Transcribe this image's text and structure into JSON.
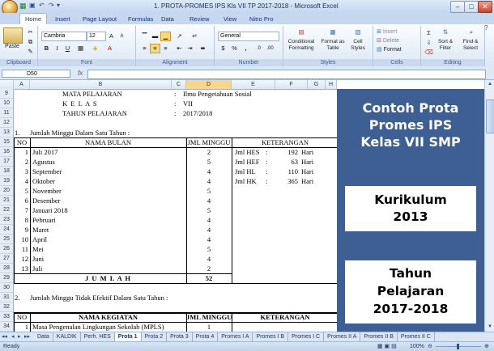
{
  "window": {
    "title": "1. PROTA-PROMES IPS Kls VII TP 2017-2018 - Microsoft Excel"
  },
  "ribbon": {
    "tabs": [
      "Home",
      "Insert",
      "Page Layout",
      "Formulas",
      "Data",
      "Review",
      "View",
      "Nitro Pro"
    ],
    "active_tab": "Home",
    "groups": {
      "clipboard": "Clipboard",
      "font": "Font",
      "alignment": "Alignment",
      "number": "Number",
      "styles": "Styles",
      "cells": "Cells",
      "editing": "Editing"
    },
    "paste_label": "Paste",
    "font_name": "Cambria",
    "font_size": "12",
    "number_format": "General",
    "conditional_formatting": "Conditional Formatting",
    "format_as_table": "Format as Table",
    "cell_styles": "Cell Styles",
    "insert": "Insert",
    "delete": "Delete",
    "format": "Format",
    "sort_filter": "Sort & Filter",
    "find_select": "Find & Select",
    "bold": "B",
    "italic": "I",
    "underline": "U",
    "percent": "%",
    "comma": ",",
    "sigma": "Σ"
  },
  "formula_bar": {
    "name_box": "D50",
    "fx": "fx",
    "content": ""
  },
  "columns": [
    "A",
    "B",
    "C",
    "D",
    "E",
    "F",
    "G",
    "H"
  ],
  "rows": [
    "9",
    "10",
    "11",
    "12",
    "13",
    "15",
    "16",
    "17",
    "18",
    "19",
    "20",
    "21",
    "22",
    "23",
    "24",
    "25",
    "26",
    "27",
    "28",
    "29",
    "30",
    "31",
    "32",
    "33",
    "34"
  ],
  "sheet": {
    "r9": {
      "label": "MATA PELAJARAN",
      "sep": ":",
      "value": "Ilmu Pengetahuan Sosial"
    },
    "r10": {
      "label": "K E L A S",
      "sep": ":",
      "value": "VII"
    },
    "r11": {
      "label": "TAHUN PELAJARAN",
      "sep": ":",
      "value": "2017/2018"
    },
    "r13": {
      "num": "1.",
      "text": "Jumlah Minggu Dalam Satu Tahun :"
    },
    "table1_headers": {
      "no": "NO",
      "bulan": "NAMA BULAN",
      "jml": "JML MINGGU",
      "ket": "KETERANGAN"
    },
    "table1_rows": [
      {
        "no": "1",
        "bulan": "Juli 2017",
        "jml": "2"
      },
      {
        "no": "2",
        "bulan": "Agustus",
        "jml": "5"
      },
      {
        "no": "3",
        "bulan": "September",
        "jml": "4"
      },
      {
        "no": "4",
        "bulan": "Oktober",
        "jml": "4"
      },
      {
        "no": "5",
        "bulan": "November",
        "jml": "5"
      },
      {
        "no": "6",
        "bulan": "Desember",
        "jml": "4"
      },
      {
        "no": "7",
        "bulan": "Januari 2018",
        "jml": "5"
      },
      {
        "no": "8",
        "bulan": "Pebruari",
        "jml": "4"
      },
      {
        "no": "9",
        "bulan": "Maret",
        "jml": "4"
      },
      {
        "no": "10",
        "bulan": "April",
        "jml": "4"
      },
      {
        "no": "11",
        "bulan": "Mei",
        "jml": "5"
      },
      {
        "no": "12",
        "bulan": "Juni",
        "jml": "4"
      },
      {
        "no": "13",
        "bulan": "Juli",
        "jml": "2"
      }
    ],
    "keterangan": [
      {
        "label": "Jml HES",
        "sep": ":",
        "value": "192",
        "unit": "Hari"
      },
      {
        "label": "Jml HEF",
        "sep": ":",
        "value": "63",
        "unit": "Hari"
      },
      {
        "label": "Jml HL",
        "sep": ":",
        "value": "110",
        "unit": "Hari"
      },
      {
        "label": "Jml HK",
        "sep": ":",
        "value": "365",
        "unit": "Hari"
      }
    ],
    "total_label": "J U M L A H",
    "total_value": "52",
    "r31": {
      "num": "2.",
      "text": "Jumlah Minggu Tidak Efektif Dalam Satu Tahun :"
    },
    "table2_headers": {
      "no": "NO",
      "kegiatan": "NAMA KEGIATAN",
      "jml": "JML MINGGU",
      "ket": "KETERANGAN"
    },
    "table2_rows": [
      {
        "no": "1",
        "kegiatan": "Masa Pengenalan Lingkungan Sekolah (MPLS)",
        "jml": "1"
      }
    ]
  },
  "banner": {
    "line1": "Contoh Prota",
    "line2": "Promes IPS",
    "line3": "Kelas VII SMP",
    "line4": "Kurikulum",
    "line5": "2013",
    "line6": "Tahun",
    "line7": "Pelajaran",
    "line8": "2017-2018",
    "bg_color": "#3d5f93"
  },
  "sheet_tabs": [
    "Data",
    "KALDIK",
    "Perh. HES",
    "Prota 1",
    "Prota 2",
    "Prota 3",
    "Prota 4",
    "Promes I A",
    "Promes I B",
    "Promes I C",
    "Promes II A",
    "Promes II B",
    "Promes II C"
  ],
  "active_sheet_tab": "Prota 1",
  "status": {
    "ready": "Ready",
    "zoom": "100%"
  }
}
